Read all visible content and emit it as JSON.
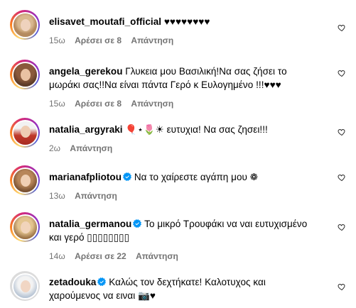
{
  "comments": [
    {
      "username": "elisavet_moutafi_official",
      "verified": false,
      "text": " ♥♥♥♥♥♥♥♥",
      "text2": "",
      "time": "15ω",
      "likes": "Αρέσει σε 8",
      "reply": "Απάντηση"
    },
    {
      "username": "angela_gerekou",
      "verified": false,
      "text": " Γλυκεια μου Βασιλική!Να σας ζήσει το",
      "text2": "μωράκι σας!!Να είναι πάντα Γερό κ Ευλογημένο !!!♥♥♥",
      "time": "15ω",
      "likes": "Αρέσει σε 8",
      "reply": "Απάντηση"
    },
    {
      "username": "natalia_argyraki",
      "verified": false,
      "text": " 🎈⋆🌷☀ ευτυχια! Να σας ζησει!!!",
      "text2": "",
      "time": "2ω",
      "likes": "",
      "reply": "Απάντηση"
    },
    {
      "username": "marianafpliotou",
      "verified": true,
      "text": " Να το χαίρεστε αγάπη μου ❁",
      "text2": "",
      "time": "13ω",
      "likes": "",
      "reply": "Απάντηση"
    },
    {
      "username": "natalia_germanou",
      "verified": true,
      "text": " Το μικρό Τρουφάκι να ναι ευτυχισμένο",
      "text2": "και γερό ▯▯▯▯▯▯▯▯",
      "time": "14ω",
      "likes": "Αρέσει σε 22",
      "reply": "Απάντηση"
    },
    {
      "username": "zetadouka",
      "verified": true,
      "text": " Καλώς τον δεχτήκατε! Καλοτυχος και",
      "text2": "χαρούμενος να ειναι 📷♥",
      "time": "",
      "likes": "",
      "reply": ""
    }
  ],
  "colors": {
    "meta": "#737373",
    "verified": "#0095f6",
    "text": "#000000"
  }
}
